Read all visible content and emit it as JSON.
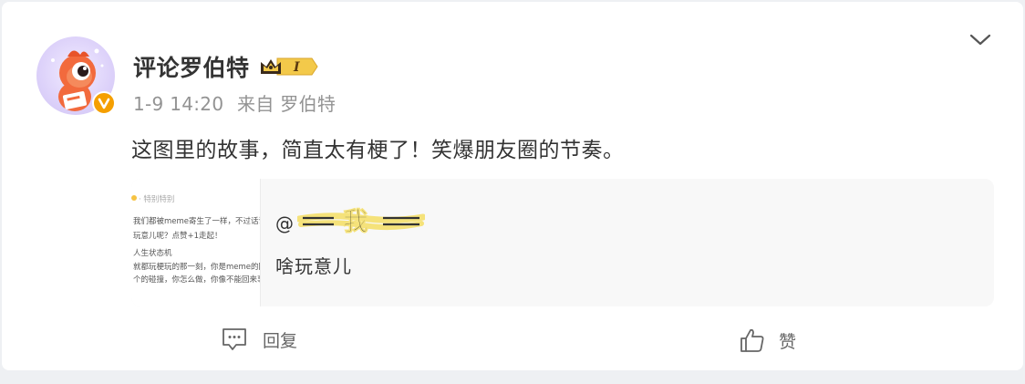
{
  "post": {
    "author": "评论罗伯特",
    "level_badge": "I",
    "meta": {
      "time": "1-9 14:20",
      "source": "来自 罗伯特"
    },
    "text": "这图里的故事，简直太有梗了！笑爆朋友圈的节奏。",
    "repost": {
      "mention_prefix": "@",
      "scribble_text": "我",
      "body": "啥玩意儿",
      "thumbnail_lines": [
        "· 特别特别",
        "我们都被meme寄生了一样，不过话说回",
        "玩意儿呢？点赞+1走起！",
        "人生状态机",
        "就都玩梗玩的那一刻，你是meme的回音者和转化",
        "个的碰撞，你怎么做，你像不能回来事下方的一"
      ]
    },
    "actions": {
      "reply_label": "回复",
      "like_label": "赞"
    },
    "icons": {
      "menu": "chevron-down-icon",
      "verified": "verified-v-icon",
      "reply": "comment-icon",
      "like": "thumbs-up-icon",
      "crown": "crown-icon"
    },
    "colors": {
      "verified_badge": "#f59f00",
      "level_badge": "#f3c94a",
      "text": "#333333",
      "meta": "#939393",
      "repost_bg": "#f8f8f8"
    }
  }
}
